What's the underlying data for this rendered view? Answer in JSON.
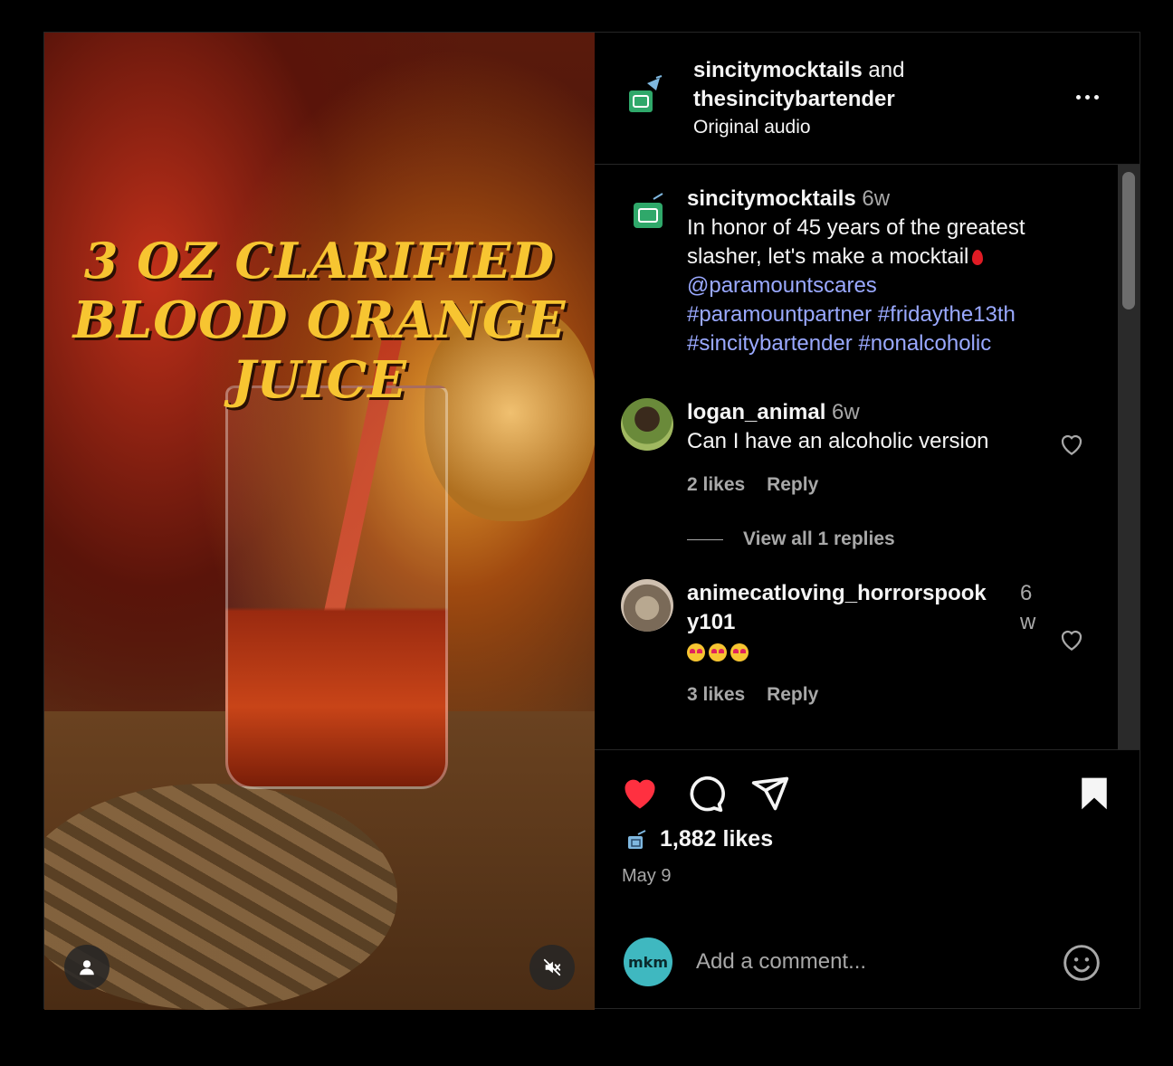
{
  "media": {
    "overlay_line1": "3 OZ CLARIFIED",
    "overlay_line2": "BLOOD ORANGE JUICE"
  },
  "header": {
    "author1": "sincitymocktails",
    "and_text": " and",
    "author2": "thesincitybartender",
    "audio": "Original audio"
  },
  "caption": {
    "username": "sincitymocktails",
    "time": "6w",
    "text": "In honor of 45 years of the greatest slasher, let's make a mocktail",
    "mention": "@paramountscares",
    "tags_line1": "#paramountpartner #fridaythe13th",
    "tags_line2": "#sincitybartender #nonalcoholic"
  },
  "comments": [
    {
      "username": "logan_animal",
      "time": "6w",
      "text": "Can I have an alcoholic version",
      "likes": "2 likes",
      "reply": "Reply",
      "view_replies": "View all 1 replies"
    },
    {
      "username_line1": "animecatloving_horrorspook",
      "username_line2": "y101",
      "time_line1": "6",
      "time_line2": "w",
      "likes": "3 likes",
      "reply": "Reply"
    }
  ],
  "actions": {
    "likes_count": "1,882 likes",
    "date": "May 9",
    "liked": true,
    "saved": true
  },
  "add_comment": {
    "avatar_text": "mkm",
    "placeholder": "Add a comment..."
  },
  "colors": {
    "heart_red": "#ff3040",
    "link_blue": "#9aa9ff",
    "overlay_yellow": "#f7c531"
  }
}
